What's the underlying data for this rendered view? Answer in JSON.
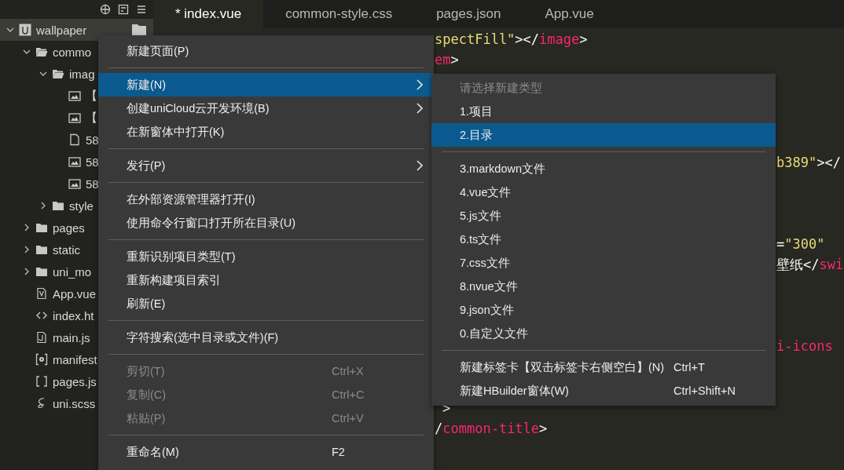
{
  "tabs": [
    {
      "label": "* index.vue",
      "selected": true
    },
    {
      "label": "common-style.css",
      "selected": false
    },
    {
      "label": "pages.json",
      "selected": false
    },
    {
      "label": "App.vue",
      "selected": false
    }
  ],
  "tree": [
    {
      "label": "wallpaper",
      "kind": "project",
      "expanded": true,
      "selected": true,
      "children": [
        {
          "label": "commo",
          "kind": "folder",
          "expanded": true,
          "selected": false,
          "children": [
            {
              "label": "imag",
              "kind": "folder",
              "expanded": true,
              "selected": false,
              "children": [
                {
                  "label": "【",
                  "kind": "image",
                  "selected": false
                },
                {
                  "label": "【",
                  "kind": "image",
                  "selected": false
                },
                {
                  "label": "58",
                  "kind": "file",
                  "selected": false
                },
                {
                  "label": "58",
                  "kind": "image",
                  "selected": false
                },
                {
                  "label": "58",
                  "kind": "image",
                  "selected": false
                }
              ]
            },
            {
              "label": "style",
              "kind": "folder",
              "expanded": false,
              "selected": false
            }
          ]
        },
        {
          "label": "pages",
          "kind": "folder",
          "expanded": false,
          "selected": false
        },
        {
          "label": "static",
          "kind": "folder",
          "expanded": false,
          "selected": false
        },
        {
          "label": "uni_mo",
          "kind": "folder",
          "expanded": false,
          "selected": false
        },
        {
          "label": "App.vue",
          "kind": "vue",
          "selected": false
        },
        {
          "label": "index.ht",
          "kind": "html",
          "selected": false
        },
        {
          "label": "main.js",
          "kind": "js",
          "selected": false
        },
        {
          "label": "manifest",
          "kind": "manifest",
          "selected": false
        },
        {
          "label": "pages.js",
          "kind": "json",
          "selected": false
        },
        {
          "label": "uni.scss",
          "kind": "scss",
          "selected": false
        }
      ]
    }
  ],
  "code": [
    {
      "segments": [
        {
          "kind": "string",
          "text": "spectFill\""
        },
        {
          "kind": "punct",
          "text": "></"
        },
        {
          "kind": "tag",
          "text": "image"
        },
        {
          "kind": "punct",
          "text": ">"
        }
      ]
    },
    {
      "segments": [
        {
          "kind": "tag",
          "text": "em"
        },
        {
          "kind": "punct",
          "text": ">"
        }
      ]
    },
    {
      "segments": [
        {
          "kind": "string",
          "text": "b389\""
        },
        {
          "kind": "punct",
          "text": "></"
        }
      ]
    },
    {
      "segments": [
        {
          "kind": "punct",
          "text": "="
        },
        {
          "kind": "string",
          "text": "\"300\""
        }
      ]
    },
    {
      "segments": [
        {
          "kind": "text",
          "text": "壁纸"
        },
        {
          "kind": "punct",
          "text": "</"
        },
        {
          "kind": "tag",
          "text": "swi"
        }
      ]
    },
    {
      "segments": [
        {
          "kind": "tag",
          "text": "i-icons"
        }
      ]
    },
    {
      "segments": [
        {
          "kind": "punct",
          "text": ">"
        }
      ]
    },
    {
      "segments": [
        {
          "kind": "punct",
          "text": "/"
        },
        {
          "kind": "tag",
          "text": "common-title"
        },
        {
          "kind": "punct",
          "text": ">"
        }
      ]
    }
  ],
  "context_menu": [
    {
      "kind": "item",
      "label": "新建页面(P)",
      "selected": false,
      "disabled": false,
      "submenu": false
    },
    {
      "kind": "separator"
    },
    {
      "kind": "item",
      "label": "新建(N)",
      "selected": true,
      "disabled": false,
      "submenu": true
    },
    {
      "kind": "item",
      "label": "创建uniCloud云开发环境(B)",
      "selected": false,
      "disabled": false,
      "submenu": true
    },
    {
      "kind": "item",
      "label": "在新窗体中打开(K)",
      "selected": false,
      "disabled": false,
      "submenu": false
    },
    {
      "kind": "separator"
    },
    {
      "kind": "item",
      "label": "发行(P)",
      "selected": false,
      "disabled": false,
      "submenu": true
    },
    {
      "kind": "separator"
    },
    {
      "kind": "item",
      "label": "在外部资源管理器打开(I)",
      "selected": false,
      "disabled": false,
      "submenu": false
    },
    {
      "kind": "item",
      "label": "使用命令行窗口打开所在目录(U)",
      "selected": false,
      "disabled": false,
      "submenu": false
    },
    {
      "kind": "separator"
    },
    {
      "kind": "item",
      "label": "重新识别项目类型(T)",
      "selected": false,
      "disabled": false,
      "submenu": false
    },
    {
      "kind": "item",
      "label": "重新构建项目索引",
      "selected": false,
      "disabled": false,
      "submenu": false
    },
    {
      "kind": "item",
      "label": "刷新(E)",
      "selected": false,
      "disabled": false,
      "submenu": false
    },
    {
      "kind": "separator"
    },
    {
      "kind": "item",
      "label": "字符搜索(选中目录或文件)(F)",
      "selected": false,
      "disabled": false,
      "submenu": false
    },
    {
      "kind": "separator"
    },
    {
      "kind": "item",
      "label": "剪切(T)",
      "shortcut": "Ctrl+X",
      "selected": false,
      "disabled": true,
      "submenu": false
    },
    {
      "kind": "item",
      "label": "复制(C)",
      "shortcut": "Ctrl+C",
      "selected": false,
      "disabled": true,
      "submenu": false
    },
    {
      "kind": "item",
      "label": "粘贴(P)",
      "shortcut": "Ctrl+V",
      "selected": false,
      "disabled": true,
      "submenu": false
    },
    {
      "kind": "separator"
    },
    {
      "kind": "item",
      "label": "重命名(M)",
      "shortcut": "F2",
      "selected": false,
      "disabled": false,
      "submenu": false
    }
  ],
  "submenu": [
    {
      "kind": "item",
      "label": "请选择新建类型",
      "selected": false,
      "disabled": true
    },
    {
      "kind": "item",
      "label": "1.项目",
      "selected": false,
      "disabled": false
    },
    {
      "kind": "item",
      "label": "2.目录",
      "selected": true,
      "disabled": false
    },
    {
      "kind": "separator"
    },
    {
      "kind": "item",
      "label": "3.markdown文件",
      "selected": false,
      "disabled": false
    },
    {
      "kind": "item",
      "label": "4.vue文件",
      "selected": false,
      "disabled": false
    },
    {
      "kind": "item",
      "label": "5.js文件",
      "selected": false,
      "disabled": false
    },
    {
      "kind": "item",
      "label": "6.ts文件",
      "selected": false,
      "disabled": false
    },
    {
      "kind": "item",
      "label": "7.css文件",
      "selected": false,
      "disabled": false
    },
    {
      "kind": "item",
      "label": "8.nvue文件",
      "selected": false,
      "disabled": false
    },
    {
      "kind": "item",
      "label": "9.json文件",
      "selected": false,
      "disabled": false
    },
    {
      "kind": "item",
      "label": "0.自定义文件",
      "selected": false,
      "disabled": false
    },
    {
      "kind": "separator"
    },
    {
      "kind": "item",
      "label": "新建标签卡【双击标签卡右侧空白】(N)",
      "shortcut": "Ctrl+T",
      "selected": false,
      "disabled": false
    },
    {
      "kind": "item",
      "label": "新建HBuilder窗体(W)",
      "shortcut": "Ctrl+Shift+N",
      "selected": false,
      "disabled": false
    }
  ]
}
